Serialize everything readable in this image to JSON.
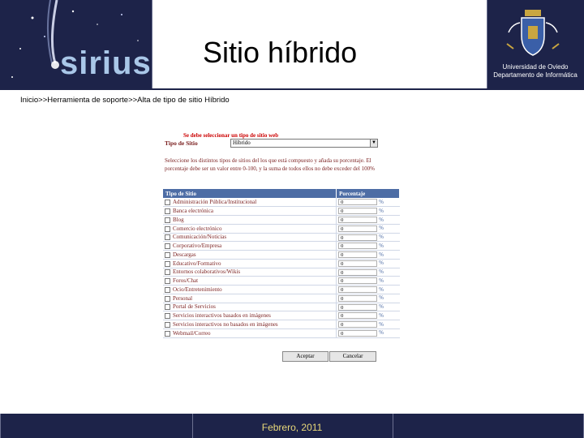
{
  "header": {
    "brand": "sirius",
    "title": "Sitio híbrido",
    "university": "Universidad de Oviedo",
    "department": "Departamento de Informática"
  },
  "breadcrumb": "Inicio>>Herramienta de soporte>>Alta de tipo de sitio Híbrido",
  "form": {
    "error_message": "Se debe seleccionar un tipo de sitio web",
    "type_label": "Tipo de Sitio",
    "type_selected": "Híbrido",
    "instructions": "Seleccione los distintos tipos de sitios del los que está compuesto y añada su porcentaje. El porcentaje debe ser un valor entre 0-100, y la suma de todos ellos no debe exceder del 100%",
    "col_type": "Tipo de Sitio",
    "col_percent": "Porcentaje",
    "percent_sign": "%",
    "rows": [
      {
        "label": "Administración Pública/Institucional",
        "value": "0"
      },
      {
        "label": "Banca electrónica",
        "value": "0"
      },
      {
        "label": "Blog",
        "value": "0"
      },
      {
        "label": "Comercio electrónico",
        "value": "0"
      },
      {
        "label": "Comunicación/Noticias",
        "value": "0"
      },
      {
        "label": "Corporativo/Empresa",
        "value": "0"
      },
      {
        "label": "Descargas",
        "value": "0"
      },
      {
        "label": "Educativo/Formativo",
        "value": "0"
      },
      {
        "label": "Entornos colaborativos/Wikis",
        "value": "0"
      },
      {
        "label": "Foros/Chat",
        "value": "0"
      },
      {
        "label": "Ocio/Entretenimiento",
        "value": "0"
      },
      {
        "label": "Personal",
        "value": "0"
      },
      {
        "label": "Portal de Servicios",
        "value": "0"
      },
      {
        "label": "Servicios interactivos basados en imágenes",
        "value": "0"
      },
      {
        "label": "Servicios interactivos no basados en imágenes",
        "value": "0"
      },
      {
        "label": "Webmail/Correo",
        "value": "0"
      }
    ],
    "accept_label": "Aceptar",
    "cancel_label": "Cancelar"
  },
  "footer": {
    "date": "Febrero, 2011"
  },
  "colors": {
    "header_band": "#1d2349",
    "table_header": "#4d6da5",
    "label_text": "#7a1f1f",
    "error_text": "#cc0000",
    "footer_text": "#e8d879"
  }
}
